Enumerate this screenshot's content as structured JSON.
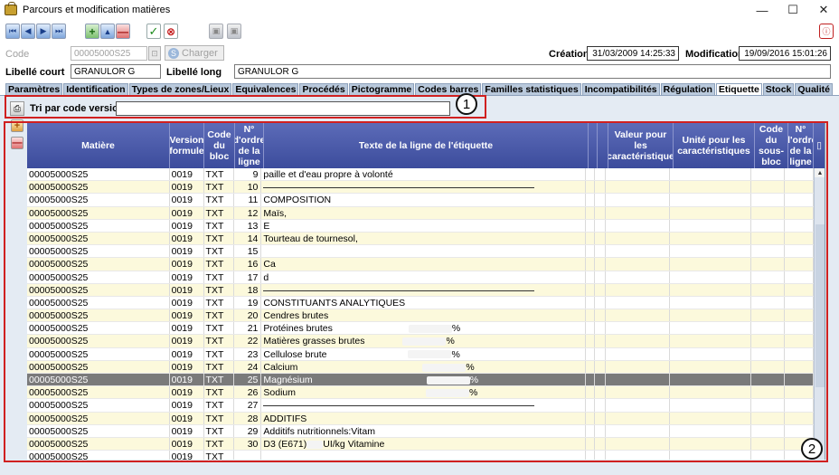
{
  "window": {
    "title": "Parcours et modification matières",
    "minimize": "—",
    "maximize": "☐",
    "close": "✕"
  },
  "toolbar": {
    "first": "⏮",
    "prev": "◀",
    "next": "▶",
    "last": "⏭",
    "add": "+",
    "up": "▲",
    "remove": "—",
    "validate": "✓",
    "cancel": "⊗",
    "copy": "▣",
    "paste": "▣",
    "help": "ⓘ"
  },
  "header": {
    "code_label": "Code",
    "code_value": "00005000S25",
    "charger_label": "Charger",
    "creation_label": "Création",
    "creation_value": "31/03/2009 14:25:33",
    "modification_label": "Modification",
    "modification_value": "19/09/2016 15:01:26",
    "libelle_court_label": "Libellé court",
    "libelle_court_value": "GRANULOR G",
    "libelle_long_label": "Libellé long",
    "libelle_long_value": "GRANULOR G"
  },
  "tabs": [
    {
      "label": "Paramètres"
    },
    {
      "label": "Identification"
    },
    {
      "label": "Types de zones/Lieux"
    },
    {
      "label": "Equivalences"
    },
    {
      "label": "Procédés"
    },
    {
      "label": "Pictogramme"
    },
    {
      "label": "Codes barres"
    },
    {
      "label": "Familles statistiques"
    },
    {
      "label": "Incompatibilités"
    },
    {
      "label": "Régulation"
    },
    {
      "label": "Etiquette",
      "active": true
    },
    {
      "label": "Stock"
    },
    {
      "label": "Qualité"
    }
  ],
  "sort": {
    "label": "Tri par code version",
    "value": ""
  },
  "callouts": {
    "one": "1",
    "two": "2"
  },
  "table": {
    "columns": {
      "matiere": "Matière",
      "version": "Version formule",
      "code_bloc": "Code du bloc",
      "ordre": "N° d'ordre de la ligne",
      "texte": "Texte de la ligne de l'étiquette",
      "valeur": "Valeur pour les caractéristique",
      "unite": "Unité pour les caractéristiques",
      "code_sous_bloc": "Code du sous-bloc",
      "ordre2": "N° d'ordre de la ligne"
    },
    "rows": [
      {
        "m": "00005000S25",
        "v": "0019",
        "c": "TXT",
        "n": "9",
        "t": "paille et d'eau propre à volonté",
        "blank": false
      },
      {
        "m": "00005000S25",
        "v": "0019",
        "c": "TXT",
        "n": "10",
        "t": "",
        "blank": true
      },
      {
        "m": "00005000S25",
        "v": "0019",
        "c": "TXT",
        "n": "11",
        "t": "COMPOSITION",
        "blank": false
      },
      {
        "m": "00005000S25",
        "v": "0019",
        "c": "TXT",
        "n": "12",
        "t": "Maïs,",
        "blank": false
      },
      {
        "m": "00005000S25",
        "v": "0019",
        "c": "TXT",
        "n": "13",
        "t": "E",
        "blank": false
      },
      {
        "m": "00005000S25",
        "v": "0019",
        "c": "TXT",
        "n": "14",
        "t": "Tourteau de tournesol,",
        "blank": false
      },
      {
        "m": "00005000S25",
        "v": "0019",
        "c": "TXT",
        "n": "15",
        "t": "",
        "blank": false
      },
      {
        "m": "00005000S25",
        "v": "0019",
        "c": "TXT",
        "n": "16",
        "t": "Ca",
        "blank": false
      },
      {
        "m": "00005000S25",
        "v": "0019",
        "c": "TXT",
        "n": "17",
        "t": "d",
        "blank": false
      },
      {
        "m": "00005000S25",
        "v": "0019",
        "c": "TXT",
        "n": "18",
        "t": "",
        "blank": true
      },
      {
        "m": "00005000S25",
        "v": "0019",
        "c": "TXT",
        "n": "19",
        "t": "CONSTITUANTS ANALYTIQUES",
        "blank": false
      },
      {
        "m": "00005000S25",
        "v": "0019",
        "c": "TXT",
        "n": "20",
        "t": "Cendres brutes",
        "blank": false
      },
      {
        "m": "00005000S25",
        "v": "0019",
        "c": "TXT",
        "n": "21",
        "t": "Protéines brutes",
        "blank": false,
        "pct": "%"
      },
      {
        "m": "00005000S25",
        "v": "0019",
        "c": "TXT",
        "n": "22",
        "t": "Matières grasses brutes",
        "blank": false,
        "pct": "%"
      },
      {
        "m": "00005000S25",
        "v": "0019",
        "c": "TXT",
        "n": "23",
        "t": "Cellulose brute",
        "blank": false,
        "pct": "%"
      },
      {
        "m": "00005000S25",
        "v": "0019",
        "c": "TXT",
        "n": "24",
        "t": "Calcium",
        "blank": false,
        "pct": "%"
      },
      {
        "m": "00005000S25",
        "v": "0019",
        "c": "TXT",
        "n": "25",
        "t": "Magnésium",
        "blank": false,
        "pct": "%",
        "selected": true
      },
      {
        "m": "00005000S25",
        "v": "0019",
        "c": "TXT",
        "n": "26",
        "t": "Sodium",
        "blank": false,
        "pct": "%"
      },
      {
        "m": "00005000S25",
        "v": "0019",
        "c": "TXT",
        "n": "27",
        "t": "",
        "blank": true
      },
      {
        "m": "00005000S25",
        "v": "0019",
        "c": "TXT",
        "n": "28",
        "t": "ADDITIFS",
        "blank": false
      },
      {
        "m": "00005000S25",
        "v": "0019",
        "c": "TXT",
        "n": "29",
        "t": "Additifs nutritionnels:Vitam",
        "blank": false
      },
      {
        "m": "00005000S25",
        "v": "0019",
        "c": "TXT",
        "n": "30",
        "t": "D3 (E671)",
        "blank": false,
        "tail": "UI/kg Vitamine"
      },
      {
        "m": "00005000S25",
        "v": "0019",
        "c": "TXT",
        "n": "",
        "t": "",
        "blank": false
      }
    ]
  }
}
